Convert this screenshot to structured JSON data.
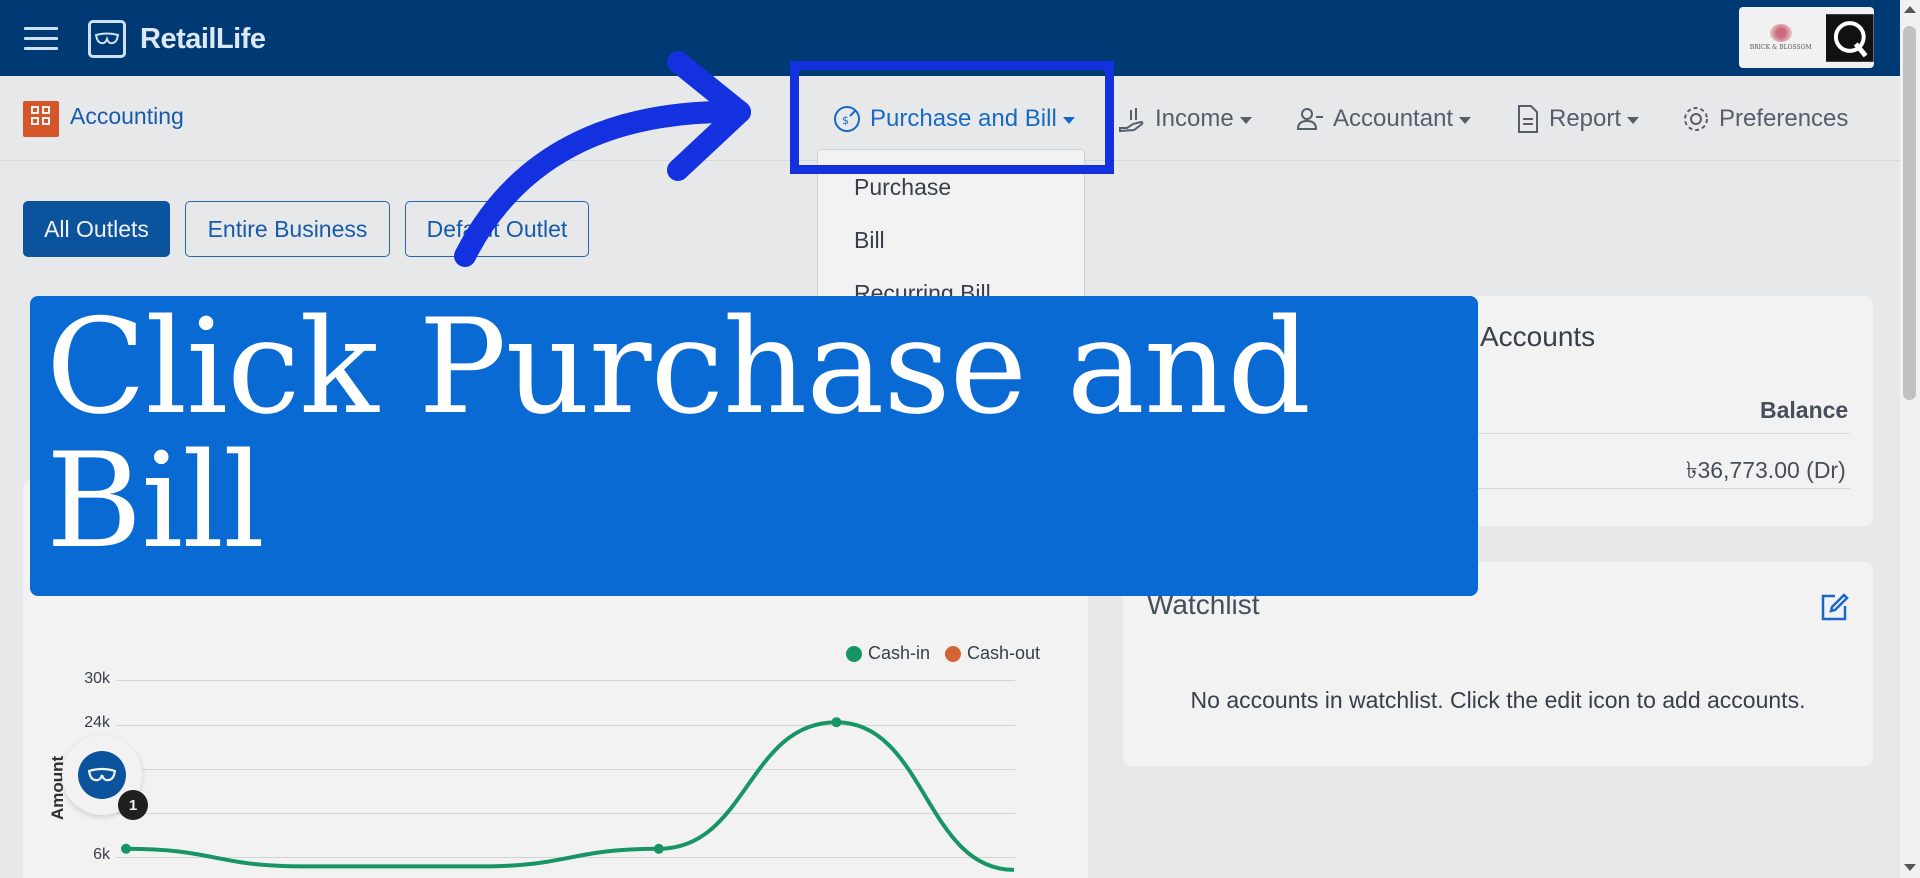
{
  "app": {
    "name": "RetailLife"
  },
  "subnav": {
    "module": "Accounting",
    "items": [
      {
        "label": "Purchase and Bill"
      },
      {
        "label": "Income"
      },
      {
        "label": "Accountant"
      },
      {
        "label": "Report"
      },
      {
        "label": "Preferences"
      }
    ]
  },
  "dropdown": {
    "items": [
      "Purchase",
      "Bill",
      "Recurring Bill"
    ]
  },
  "outlets": {
    "all": "All Outlets",
    "entire": "Entire Business",
    "default": "Default Outlet"
  },
  "accounts_card": {
    "title": "Accounts",
    "balance_header": "Balance",
    "balance_value": "৳36,773.00 (Dr)"
  },
  "watchlist": {
    "title": "Watchlist",
    "empty_text": "No accounts in watchlist. Click the edit icon to add accounts."
  },
  "helper": {
    "badge": "1"
  },
  "banner": {
    "text": "Click Purchase and Bill"
  },
  "colors": {
    "topbar": "#003a75",
    "accent": "#1a6fd0",
    "banner": "#0a6ad4",
    "highlight": "#1431e0",
    "cash_in": "#1a9e6b",
    "cash_out": "#e06a3c"
  },
  "chart_data": {
    "type": "line",
    "ylabel": "Amount",
    "y_ticks": [
      "30k",
      "24k",
      "6k"
    ],
    "legend": [
      "Cash-in",
      "Cash-out"
    ],
    "series": [
      {
        "name": "Cash-in",
        "points": [
          [
            0,
            6000
          ],
          [
            1,
            3500
          ],
          [
            2,
            3500
          ],
          [
            3,
            6000
          ],
          [
            4,
            24000
          ],
          [
            5,
            3000
          ]
        ]
      }
    ],
    "ylim": [
      0,
      30000
    ],
    "grid": true,
    "legend_position": "top-right"
  }
}
